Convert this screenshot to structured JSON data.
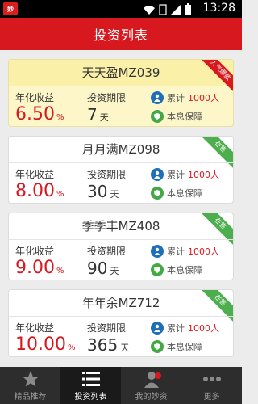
{
  "statusbar": {
    "app_badge": "妙",
    "time": "13:28"
  },
  "navbar": {
    "title": "投资列表"
  },
  "labels": {
    "rate": "年化收益",
    "term": "投资期限",
    "cumulative": "累计",
    "guarantee": "本息保障",
    "rate_unit": "%",
    "day_unit": "天"
  },
  "products": [
    {
      "name": "天天盈MZ039",
      "ribbon": "人气爆款",
      "rate": "6.50",
      "days": "7",
      "people": "1000人"
    },
    {
      "name": "月月满MZ098",
      "ribbon": "在售",
      "rate": "8.00",
      "days": "30",
      "people": "1000人"
    },
    {
      "name": "季季丰MZ408",
      "ribbon": "在售",
      "rate": "9.00",
      "days": "90",
      "people": "1000人"
    },
    {
      "name": "年年余MZ712",
      "ribbon": "在售",
      "rate": "10.00",
      "days": "365",
      "people": "1000人"
    }
  ],
  "tabs": [
    {
      "label": "精品推荐"
    },
    {
      "label": "投资列表"
    },
    {
      "label": "我的妙资"
    },
    {
      "label": "更多"
    }
  ],
  "colors": {
    "brand_red": "#d7181f",
    "status_green": "#4cae4c",
    "highlight_bg": "#fdf6c8"
  }
}
